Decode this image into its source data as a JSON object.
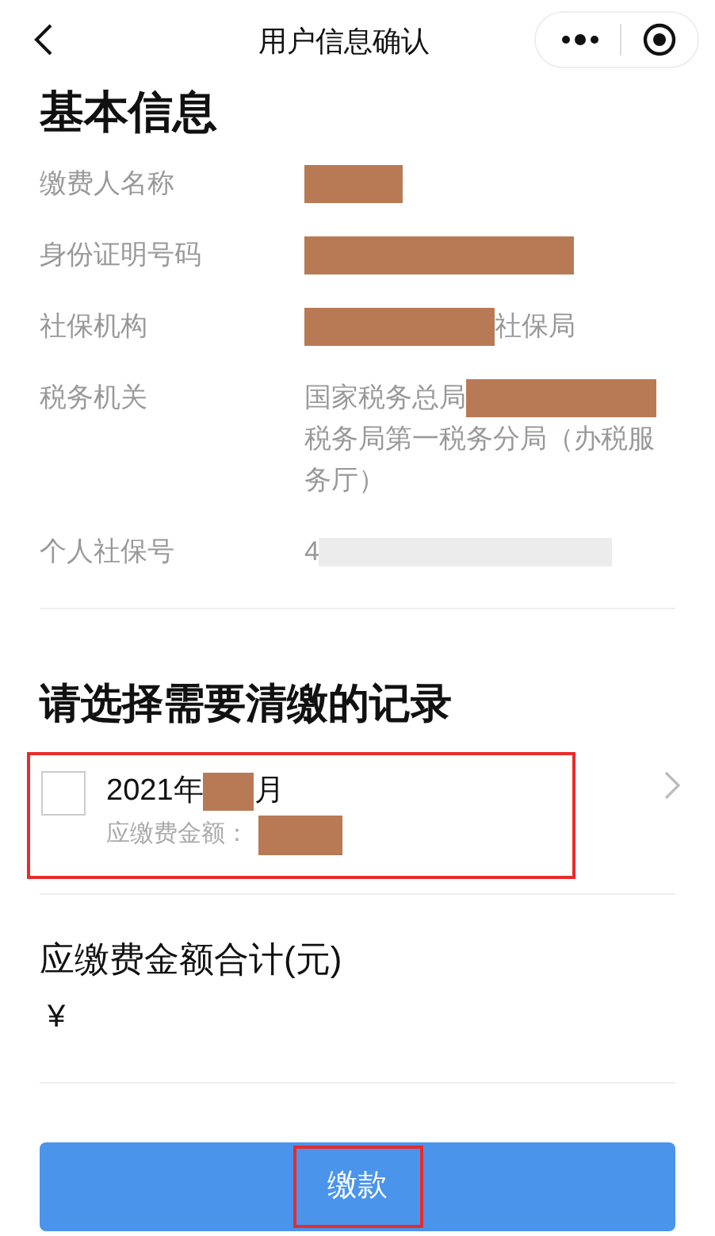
{
  "nav": {
    "title": "用户信息确认"
  },
  "basic_info": {
    "heading": "基本信息",
    "rows": [
      {
        "label": "缴费人名称",
        "value": [
          {
            "kind": "redacted_short"
          }
        ]
      },
      {
        "label": "身份证明号码",
        "value": [
          {
            "kind": "redacted_long"
          }
        ]
      },
      {
        "label": "社保机构",
        "value": [
          {
            "kind": "redacted_medium"
          },
          {
            "kind": "text",
            "text": "社保局"
          }
        ]
      },
      {
        "label": "税务机关",
        "value": [
          {
            "kind": "text",
            "text": "国家税务总局"
          },
          {
            "kind": "redacted_medium"
          },
          {
            "kind": "text",
            "text": "税务局第一税务分局（办税服务厅）"
          }
        ]
      },
      {
        "label": "个人社保号",
        "value": [
          {
            "kind": "text",
            "text": "4"
          },
          {
            "kind": "blurred"
          }
        ]
      }
    ]
  },
  "records": {
    "heading": "请选择需要清缴的记录",
    "items": [
      {
        "checked": false,
        "annotated": true,
        "year": "2021年",
        "month_suffix": "月",
        "amount_label": "应缴费金额："
      }
    ]
  },
  "total": {
    "label": "应缴费金额合计(元)",
    "value": "¥"
  },
  "pay_button": {
    "label": "缴款",
    "annotated": true
  }
}
